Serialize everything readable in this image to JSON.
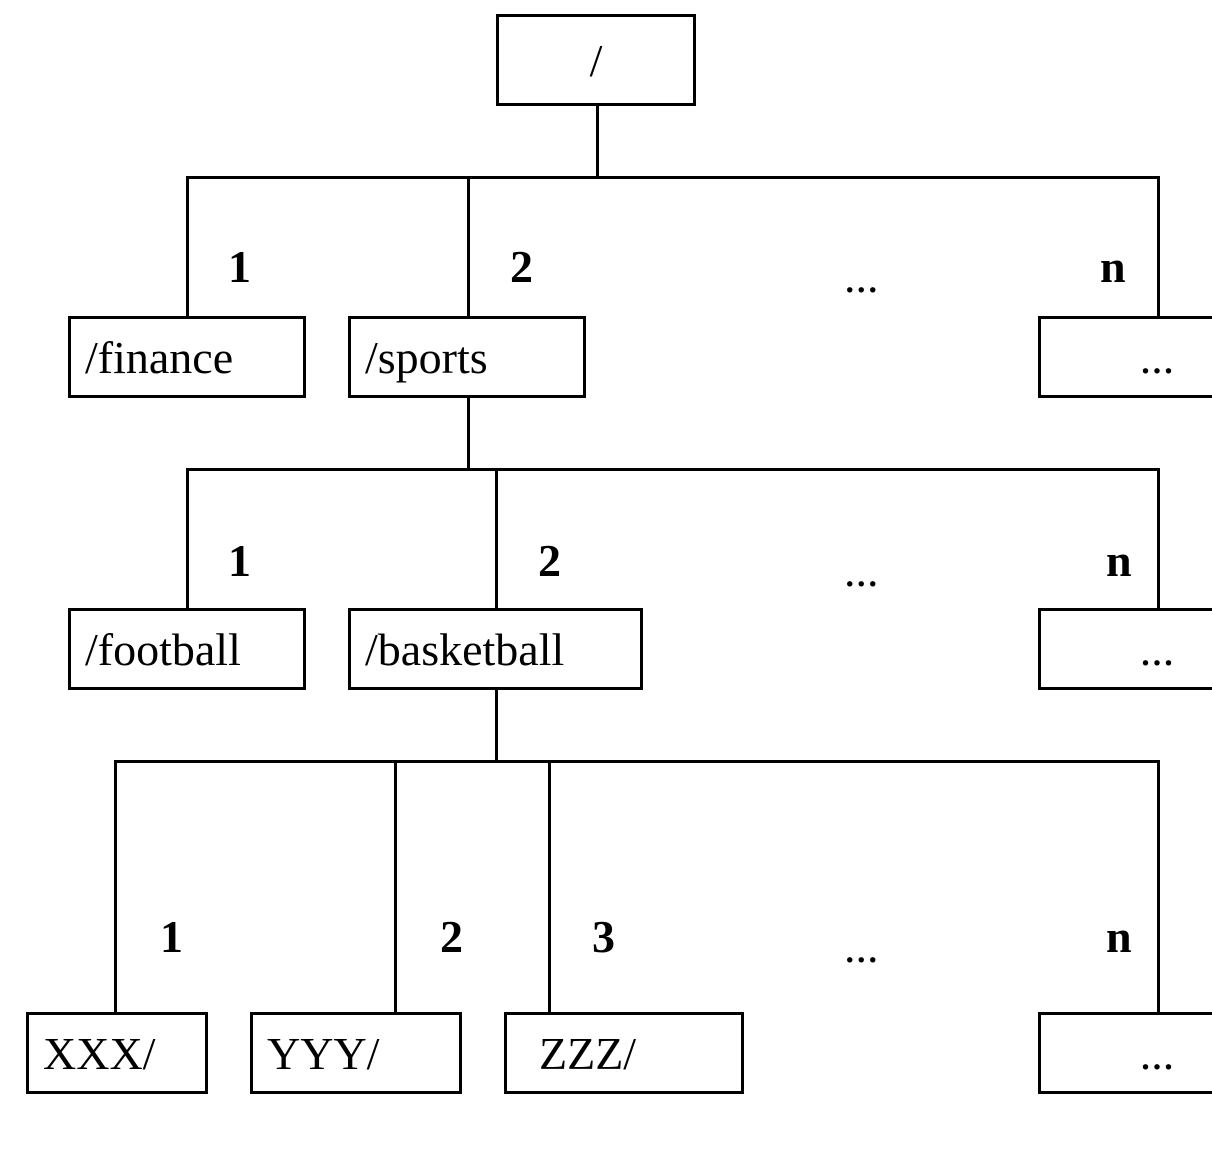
{
  "tree": {
    "root": {
      "text": "/"
    },
    "level1": {
      "edge_labels": [
        "1",
        "2",
        "...",
        "n"
      ],
      "nodes": [
        "/finance",
        "/sports",
        "..."
      ]
    },
    "level2": {
      "parent": "/sports",
      "edge_labels": [
        "1",
        "2",
        "...",
        "n"
      ],
      "nodes": [
        "/football",
        "/basketball",
        "..."
      ]
    },
    "level3": {
      "parent": "/basketball",
      "edge_labels": [
        "1",
        "2",
        "3",
        "...",
        "n"
      ],
      "nodes": [
        "XXX/",
        "YYY/",
        "ZZZ/",
        "..."
      ]
    }
  }
}
